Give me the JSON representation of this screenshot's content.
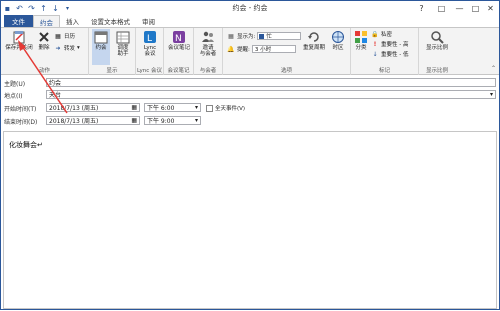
{
  "window": {
    "title": "约会 - 约会"
  },
  "titlebar": {
    "help_icon": "?",
    "restore_icon": "□",
    "min_icon": "—",
    "max_icon": "□",
    "close_icon": "✕"
  },
  "tabs": [
    {
      "label": "文件"
    },
    {
      "label": "约会"
    },
    {
      "label": "插入"
    },
    {
      "label": "设置文本格式"
    },
    {
      "label": "审阅"
    }
  ],
  "ribbon": {
    "save_close": "保存并关闭",
    "delete": "删除",
    "calendar": "日历",
    "forward": "转发",
    "actions_group": "动作",
    "appointment": "约会",
    "schedule_line1": "调度",
    "schedule_line2": "助手",
    "display_group": "显示",
    "lync_line1": "Lync",
    "lync_line2": "会议",
    "lync_group": "Lync 会议",
    "meeting_notes": "会议笔记",
    "notes_group": "会议笔记",
    "invite_line1": "邀请",
    "invite_line2": "与会者",
    "attendees_group": "与会者",
    "show_as_label": "显示为:",
    "show_as_value": "忙",
    "reminder_label": "提醒:",
    "reminder_value": "3 小时",
    "recurrence": "重复周期",
    "timezone": "时区",
    "options_group": "选项",
    "categorize": "分类",
    "private": "私密",
    "high": "重要性 - 高",
    "low": "重要性 - 低",
    "tags_group": "标记",
    "zoom": "显示比例",
    "zoom_group": "显示比例"
  },
  "form": {
    "subject_label": "主题(U)",
    "subject_value": "约会",
    "location_label": "地点(I)",
    "location_value": "天台",
    "start_label": "开始时间(T)",
    "start_date": "2018/7/13 (周五)",
    "start_time": "下午 6:00",
    "allday_label": "全天事件(V)",
    "end_label": "结束时间(D)",
    "end_date": "2018/7/13 (周五)",
    "end_time": "下午 9:00"
  },
  "body": {
    "text": "化妆舞会↵"
  },
  "colors": {
    "accent": "#2b579a",
    "arrow": "#e53935"
  }
}
